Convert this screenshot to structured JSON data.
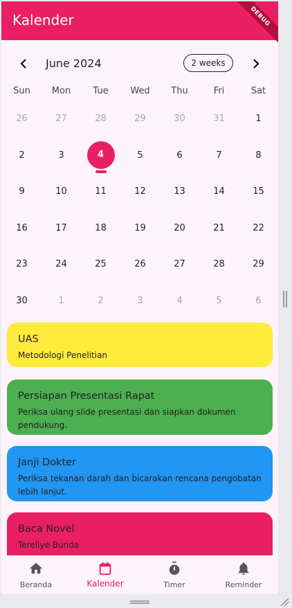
{
  "app": {
    "title": "Kalender",
    "debug_label": "DEBUG",
    "accent": "#e91e63"
  },
  "calendar": {
    "month_title": "June 2024",
    "format_button": "2 weeks",
    "days_of_week": [
      "Sun",
      "Mon",
      "Tue",
      "Wed",
      "Thu",
      "Fri",
      "Sat"
    ],
    "weeks": [
      [
        {
          "d": "26",
          "out": true
        },
        {
          "d": "27",
          "out": true
        },
        {
          "d": "28",
          "out": true
        },
        {
          "d": "29",
          "out": true
        },
        {
          "d": "30",
          "out": true
        },
        {
          "d": "31",
          "out": true
        },
        {
          "d": "1",
          "out": false
        }
      ],
      [
        {
          "d": "2",
          "out": false
        },
        {
          "d": "3",
          "out": false
        },
        {
          "d": "4",
          "out": false,
          "today": true
        },
        {
          "d": "5",
          "out": false
        },
        {
          "d": "6",
          "out": false
        },
        {
          "d": "7",
          "out": false
        },
        {
          "d": "8",
          "out": false
        }
      ],
      [
        {
          "d": "9",
          "out": false
        },
        {
          "d": "10",
          "out": false
        },
        {
          "d": "11",
          "out": false
        },
        {
          "d": "12",
          "out": false
        },
        {
          "d": "13",
          "out": false
        },
        {
          "d": "14",
          "out": false
        },
        {
          "d": "15",
          "out": false
        }
      ],
      [
        {
          "d": "16",
          "out": false
        },
        {
          "d": "17",
          "out": false
        },
        {
          "d": "18",
          "out": false
        },
        {
          "d": "19",
          "out": false
        },
        {
          "d": "20",
          "out": false
        },
        {
          "d": "21",
          "out": false
        },
        {
          "d": "22",
          "out": false
        }
      ],
      [
        {
          "d": "23",
          "out": false
        },
        {
          "d": "24",
          "out": false
        },
        {
          "d": "25",
          "out": false
        },
        {
          "d": "26",
          "out": false
        },
        {
          "d": "27",
          "out": false
        },
        {
          "d": "28",
          "out": false
        },
        {
          "d": "29",
          "out": false
        }
      ],
      [
        {
          "d": "30",
          "out": false
        },
        {
          "d": "1",
          "out": true
        },
        {
          "d": "2",
          "out": true
        },
        {
          "d": "3",
          "out": true
        },
        {
          "d": "4",
          "out": true
        },
        {
          "d": "5",
          "out": true
        },
        {
          "d": "6",
          "out": true
        }
      ]
    ]
  },
  "events": [
    {
      "title": "UAS",
      "description": "Metodologi Penelitian",
      "color": "#ffeb3b"
    },
    {
      "title": "Persiapan Presentasi Rapat",
      "description": "Periksa ulang slide presentasi dan siapkan dokumen pendukung.",
      "color": "#4caf50"
    },
    {
      "title": "Janji Dokter",
      "description": " Periksa tekanan darah dan bicarakan rencana pengobatan lebih lanjut.",
      "color": "#2196f3"
    },
    {
      "title": "Baca Novel",
      "description": "Tereliye Bunda",
      "color": "#e91e63"
    }
  ],
  "bottom_nav": [
    {
      "label": "Beranda",
      "icon": "home-icon",
      "active": false
    },
    {
      "label": "Kalender",
      "icon": "calendar-icon",
      "active": true
    },
    {
      "label": "Timer",
      "icon": "timer-icon",
      "active": false
    },
    {
      "label": "Reminder",
      "icon": "bell-icon",
      "active": false
    }
  ]
}
